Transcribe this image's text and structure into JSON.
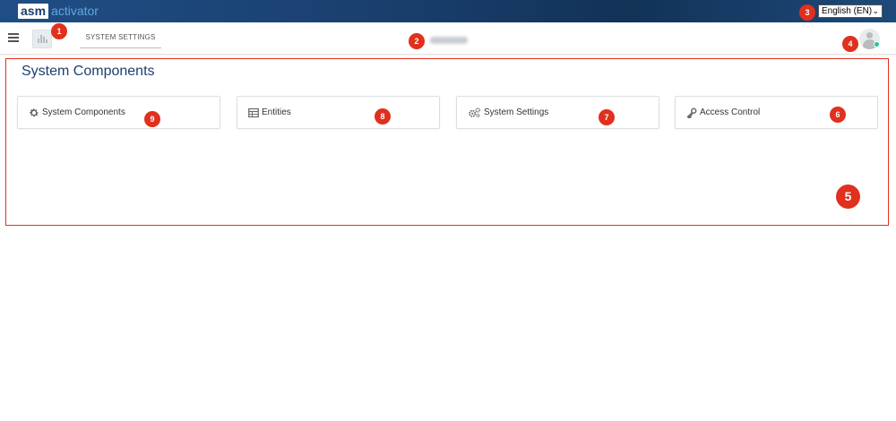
{
  "brand": {
    "logo_asm": "asm",
    "logo_product": "activator"
  },
  "header": {
    "language": "English (EN)"
  },
  "toolbar": {
    "tab_label": "SYSTEM SETTINGS"
  },
  "main": {
    "title": "System Components",
    "cards": [
      {
        "label": "System Components",
        "icon": "gear-icon"
      },
      {
        "label": "Entities",
        "icon": "table-icon"
      },
      {
        "label": "System Settings",
        "icon": "gears-icon"
      },
      {
        "label": "Access Control",
        "icon": "key-icon"
      }
    ]
  },
  "annotations": [
    "1",
    "2",
    "3",
    "4",
    "5",
    "6",
    "7",
    "8",
    "9"
  ],
  "colors": {
    "header_bg": "#1b4470",
    "title": "#1d3f6e",
    "badge": "#e0301e",
    "status_online": "#20c997"
  }
}
